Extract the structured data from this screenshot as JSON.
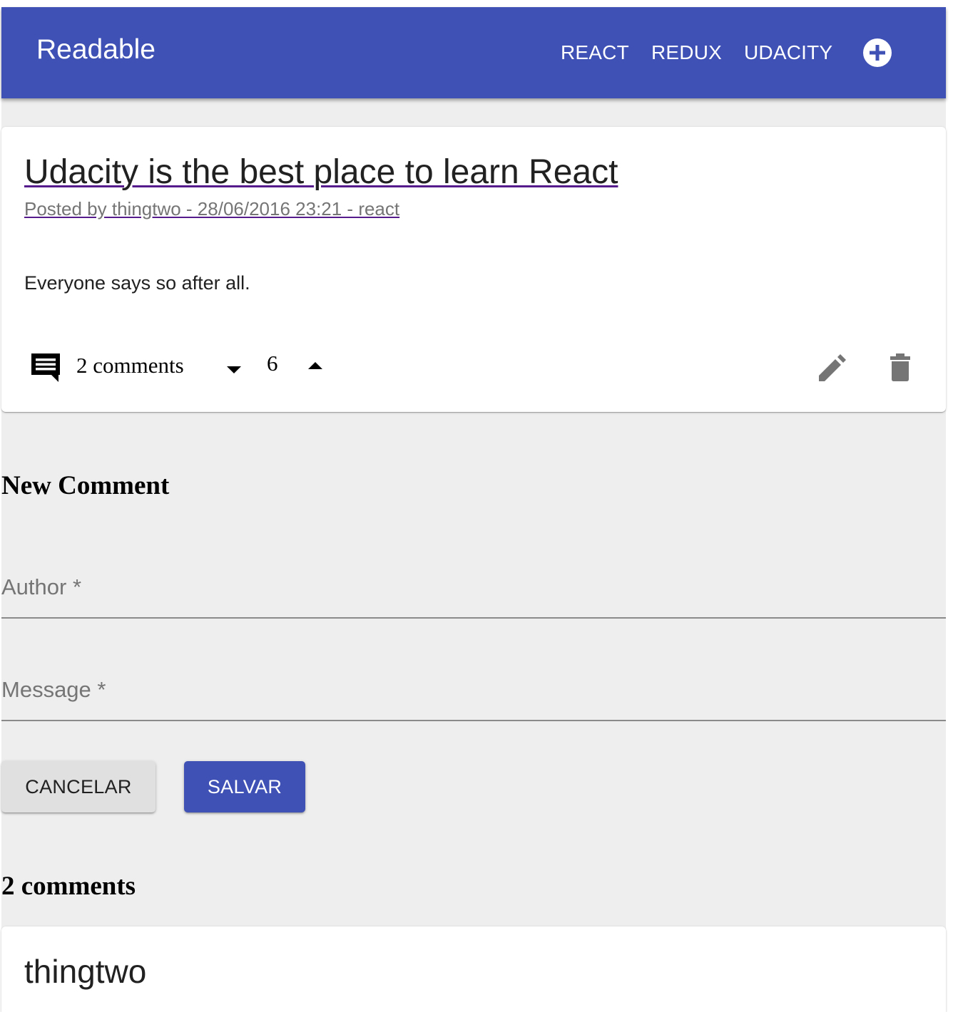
{
  "appbar": {
    "title": "Readable",
    "nav": [
      "REACT",
      "REDUX",
      "UDACITY"
    ],
    "add_icon": "add-circle-icon",
    "color": "#3f51b5"
  },
  "post": {
    "title": "Udacity is the best place to learn React",
    "meta": "Posted by thingtwo - 28/06/2016 23:21 - react",
    "body": "Everyone says so after all.",
    "comment_count_label": "2 comments",
    "score": "6",
    "icons": {
      "comments": "comment-icon",
      "vote_down": "arrow-drop-down-icon",
      "vote_up": "arrow-drop-up-icon",
      "edit": "pencil-icon",
      "delete": "trash-icon"
    }
  },
  "new_comment": {
    "heading": "New Comment",
    "author_label": "Author *",
    "message_label": "Message *",
    "cancel_label": "CANCELAR",
    "save_label": "SALVAR"
  },
  "comments": {
    "heading": "2 comments",
    "items": [
      {
        "author": "thingtwo"
      }
    ]
  }
}
